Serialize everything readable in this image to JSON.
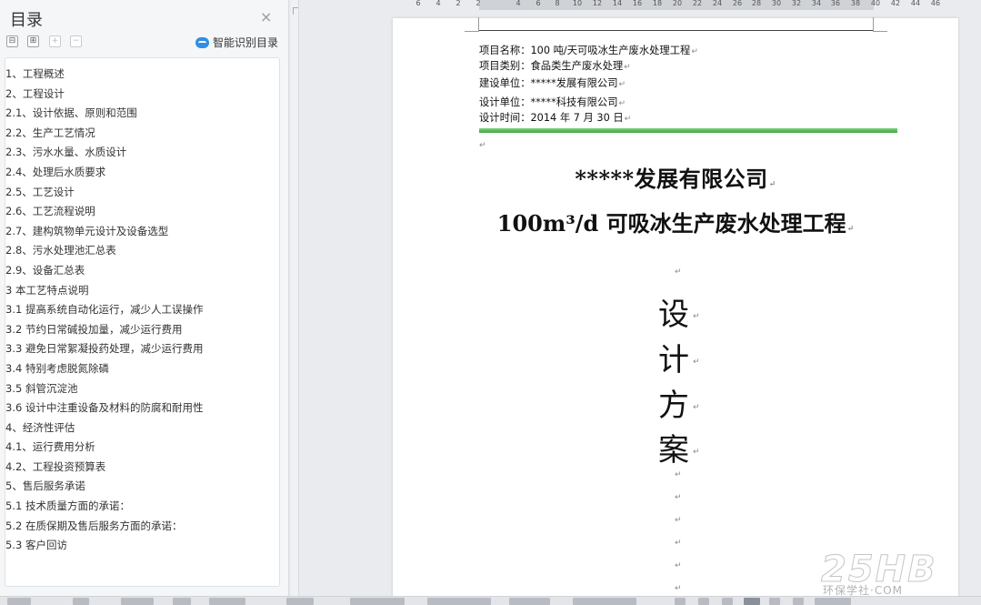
{
  "sidebar": {
    "title": "目录",
    "close": "×",
    "tools": {
      "collapse": "⊟",
      "expand": "⊞",
      "add": "+",
      "remove": "−"
    },
    "smart_toc_label": "智能识别目录",
    "items": [
      "1、工程概述",
      "2、工程设计",
      "2.1、设计依据、原则和范围",
      "2.2、生产工艺情况",
      "2.3、污水水量、水质设计",
      "2.4、处理后水质要求",
      "2.5、工艺设计",
      "2.6、工艺流程说明",
      "2.7、建构筑物单元设计及设备选型",
      "2.8、污水处理池汇总表",
      "2.9、设备汇总表",
      "3 本工艺特点说明",
      "3.1 提高系统自动化运行，减少人工误操作",
      "3.2 节约日常碱投加量，减少运行费用",
      "3.3 避免日常絮凝投药处理，减少运行费用",
      "3.4 特别考虑脱氮除磷",
      "3.5 斜管沉淀池",
      "3.6 设计中注重设备及材料的防腐和耐用性",
      "4、经济性评估",
      "4.1、运行费用分析",
      "4.2、工程投资预算表",
      "5、售后服务承诺",
      "5.1 技术质量方面的承诺：",
      "5.2 在质保期及售后服务方面的承诺：",
      "5.3 客户回访"
    ]
  },
  "ruler": {
    "ticks": [
      "6",
      "4",
      "2",
      "2",
      "4",
      "6",
      "8",
      "10",
      "12",
      "14",
      "16",
      "18",
      "20",
      "22",
      "24",
      "26",
      "28",
      "30",
      "32",
      "34",
      "36",
      "38",
      "40",
      "42",
      "44",
      "46"
    ]
  },
  "document": {
    "project_name": "项目名称：100 吨/天可吸冰生产废水处理工程",
    "project_type": "项目类别：食品类生产废水处理",
    "builder": "建设单位：*****发展有限公司",
    "designer": "设计单位：*****科技有限公司",
    "design_time": "设计时间：2014 年 7 月 30 日",
    "company": "*****发展有限公司",
    "project_title": "100m³/d 可吸冰生产废水处理工程",
    "vertical_chars": [
      "设",
      "计",
      "方",
      "案"
    ],
    "para_mark": "↵"
  },
  "watermark": {
    "logo": "25HB",
    "sub": "环保学社·COM"
  }
}
